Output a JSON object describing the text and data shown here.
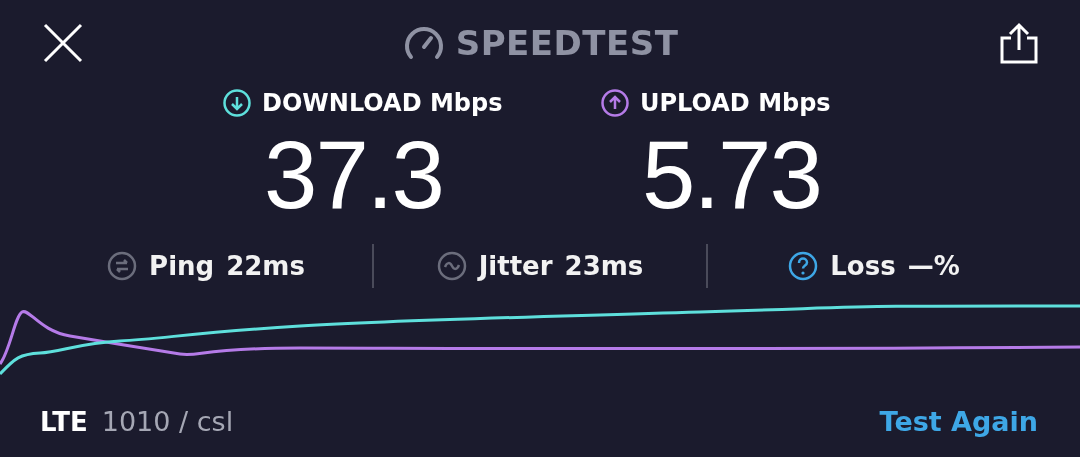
{
  "header": {
    "title": "SPEEDTEST"
  },
  "speeds": [
    {
      "kind": "download",
      "label": "DOWNLOAD Mbps",
      "value": "37.3",
      "color": "#5ee0dc"
    },
    {
      "kind": "upload",
      "label": "UPLOAD Mbps",
      "value": "5.73",
      "color": "#b57be8"
    }
  ],
  "metrics": [
    {
      "kind": "ping",
      "label": "Ping",
      "value": "22ms"
    },
    {
      "kind": "jitter",
      "label": "Jitter",
      "value": "23ms"
    },
    {
      "kind": "loss",
      "label": "Loss",
      "value": "—%"
    }
  ],
  "footer": {
    "network": "LTE",
    "carrier": "1010 / csl",
    "button": "Test Again"
  }
}
